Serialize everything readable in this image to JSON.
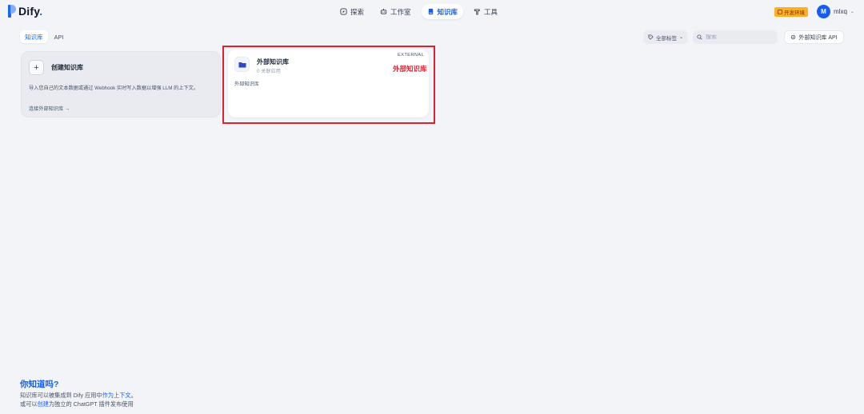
{
  "app": {
    "name": "Dify",
    "brand_color": "#155EEF"
  },
  "nav": {
    "items": [
      {
        "label": "探索",
        "icon": "compass-icon",
        "active": false
      },
      {
        "label": "工作室",
        "icon": "robot-icon",
        "active": false
      },
      {
        "label": "知识库",
        "icon": "book-icon",
        "active": true
      },
      {
        "label": "工具",
        "icon": "hammer-icon",
        "active": false
      }
    ]
  },
  "env_badge": "开发环境",
  "user": {
    "initial": "M",
    "name": "mlxq"
  },
  "subtabs": [
    {
      "label": "知识库",
      "active": true
    },
    {
      "label": "API",
      "active": false
    }
  ],
  "toolbar": {
    "tag_filter": "全部标签",
    "search_placeholder": "搜索",
    "api_button": "外部知识库 API"
  },
  "create_card": {
    "title": "创建知识库",
    "description": "导入您自己的文本数据或通过 Webhook 实时写入数据以增强 LLM 的上下文。",
    "link": "连接外部知识库 →"
  },
  "datasets": [
    {
      "name": "外部知识库",
      "meta": "0 关联应用",
      "badge": "EXTERNAL",
      "description": "外部知识库"
    }
  ],
  "annotation": {
    "label": "外部知识库",
    "color": "#E0202E"
  },
  "tip": {
    "title": "你知道吗?",
    "line1_pre": "知识库可以被集成到 Dify 应用中",
    "line1_link": "作为上下文",
    "line1_post": "。",
    "line2_pre": "或可以",
    "line2_link": "创建",
    "line2_post": "为独立的 ChatGPT 插件发布使用"
  }
}
